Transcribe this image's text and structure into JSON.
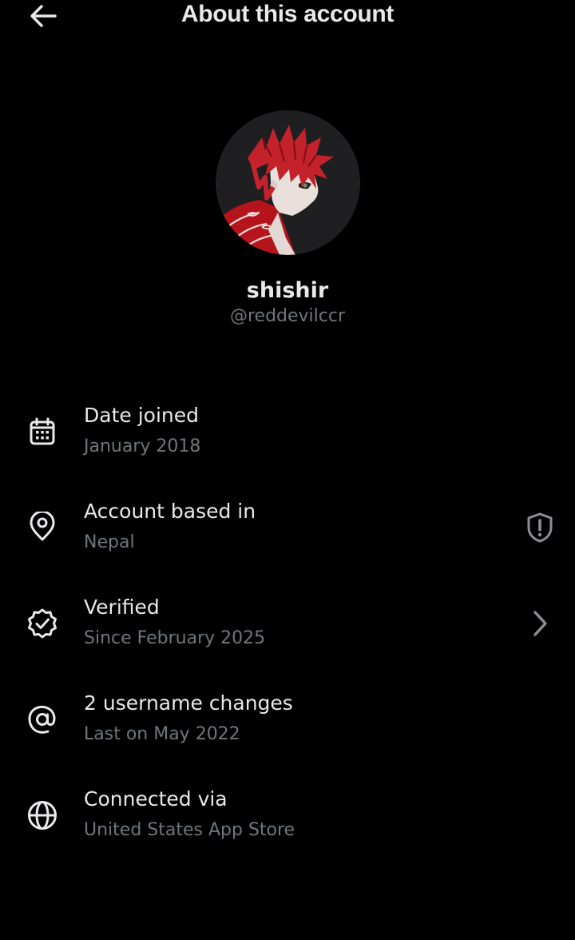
{
  "header": {
    "title": "About this account",
    "back_icon": "arrow-left-icon"
  },
  "profile": {
    "display_name": "shishir",
    "handle": "@reddevilccr",
    "avatar_icon": "avatar-anime-red-hair"
  },
  "rows": [
    {
      "label": "Date joined",
      "value": "January 2018",
      "icon": "calendar-icon"
    },
    {
      "label": "Account based in",
      "value": "Nepal",
      "icon": "location-pin-icon",
      "trailing_icon": "shield-alert-icon"
    },
    {
      "label": "Verified",
      "value": "Since February 2025",
      "icon": "verified-badge-icon",
      "trailing_icon": "chevron-right-icon"
    },
    {
      "label": "2 username changes",
      "value": "Last on May 2022",
      "icon": "at-sign-icon"
    },
    {
      "label": "Connected via",
      "value": "United States App Store",
      "icon": "globe-icon"
    }
  ],
  "colors": {
    "background": "#000000",
    "primary_text": "#e7e9ea",
    "secondary_text": "#71767b",
    "icon_trailing": "#8b9096"
  }
}
